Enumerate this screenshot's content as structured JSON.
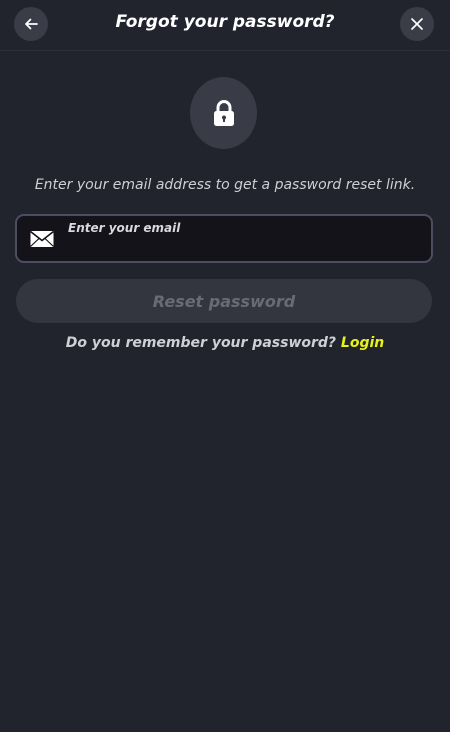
{
  "header": {
    "title": "Forgot your password?",
    "back_icon": "arrow-left-icon",
    "close_icon": "close-icon"
  },
  "main": {
    "lock_icon": "lock-icon",
    "subtitle": "Enter your email address to get a password reset link.",
    "email": {
      "label": "Enter your email",
      "value": "",
      "icon": "mail-icon"
    },
    "reset_button": "Reset password",
    "remember_text": "Do you remember your password?",
    "login_link": "Login"
  },
  "colors": {
    "background": "#21232d",
    "accent_link": "#e6f21a",
    "input_bg": "#131319",
    "button_disabled": "#33353f"
  }
}
